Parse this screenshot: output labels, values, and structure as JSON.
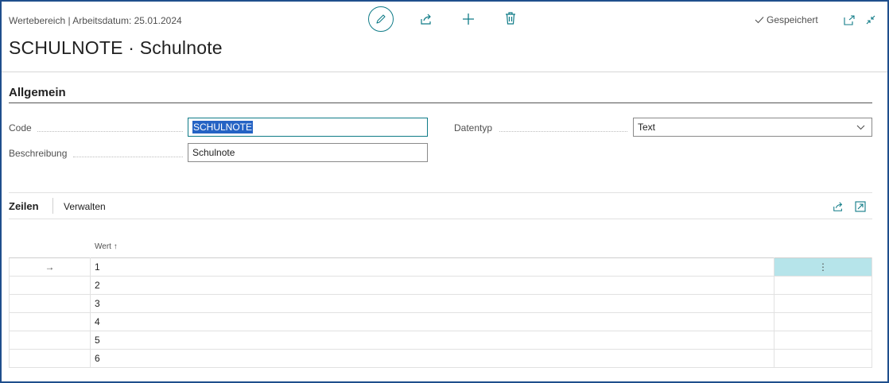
{
  "header": {
    "breadcrumb": "Wertebereich | Arbeitsdatum: 25.01.2024",
    "title": "SCHULNOTE · Schulnote",
    "saved_status": "Gespeichert",
    "toolbar_icons": [
      "edit-icon",
      "share-icon",
      "new-icon",
      "delete-icon"
    ],
    "window_icons": [
      "open-in-new-window-icon",
      "collapse-icon"
    ]
  },
  "general": {
    "title": "Allgemein",
    "code_label": "Code",
    "code_value": "SCHULNOTE",
    "description_label": "Beschreibung",
    "description_value": "Schulnote",
    "datatype_label": "Datentyp",
    "datatype_value": "Text"
  },
  "lines": {
    "tab_lines": "Zeilen",
    "tab_manage": "Verwalten",
    "column_value": "Wert",
    "sort_indicator": "↑",
    "row_arrow": "→",
    "row_menu": "⋮",
    "rows": [
      "1",
      "2",
      "3",
      "4",
      "5",
      "6"
    ]
  },
  "colors": {
    "accent": "#0f7b87",
    "selection": "#2563c4",
    "active_cell": "#b6e4ea",
    "frame": "#1f4e8c"
  }
}
